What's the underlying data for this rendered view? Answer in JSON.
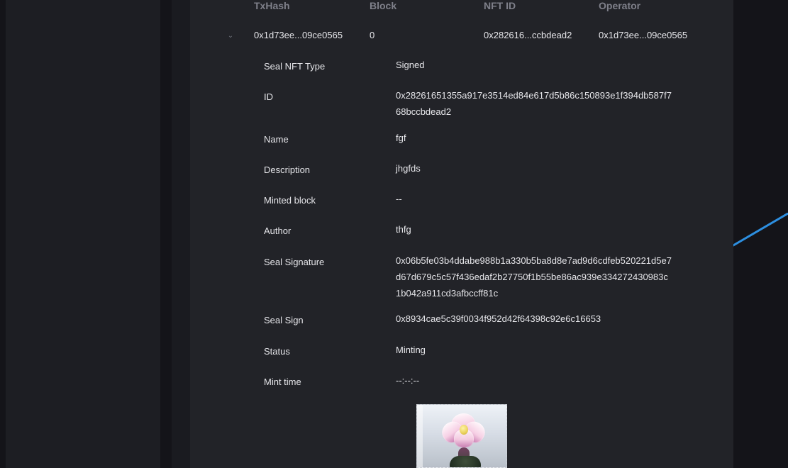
{
  "table": {
    "headers": {
      "txhash": "TxHash",
      "block": "Block",
      "nftid": "NFT ID",
      "operator": "Operator"
    },
    "row": {
      "txhash": "0x1d73ee...09ce0565",
      "block": "0",
      "nftid": "0x282616...ccbdead2",
      "operator": "0x1d73ee...09ce0565"
    }
  },
  "details": [
    {
      "label": "Seal NFT Type",
      "value": "Signed"
    },
    {
      "label": "ID",
      "value": "0x28261651355a917e3514ed84e617d5b86c150893e1f394db587f768bccbdead2"
    },
    {
      "label": "Name",
      "value": "fgf"
    },
    {
      "label": "Description",
      "value": "jhgfds"
    },
    {
      "label": "Minted block",
      "value": "--"
    },
    {
      "label": "Author",
      "value": "thfg"
    },
    {
      "label": "Seal Signature",
      "value": "0x06b5fe03b4ddabe988b1a330b5ba8d8e7ad9d6cdfeb520221d5e7d67d679c5c57f436edaf2b27750f1b55be86ac939e334272430983c1b042a911cd3afbccff81c"
    },
    {
      "label": "Seal Sign",
      "value": "0x8934cae5c39f0034f952d42f64398c92e6c16653"
    },
    {
      "label": "Status",
      "value": "Minting"
    },
    {
      "label": "Mint time",
      "value": "--:--:--"
    }
  ],
  "ui": {
    "chevron_icon": "chevron-down-icon",
    "accent_line_color": "#2d8fe0"
  }
}
